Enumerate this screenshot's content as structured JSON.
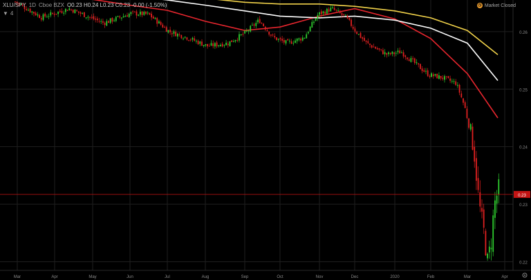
{
  "header": {
    "symbol": "XLU/SPY",
    "interval": "1D",
    "source": "Cboe BZX",
    "ohlc_text": "O0.23  H0.24  L0.23  C0.23  -0.00 (-1.50%)",
    "collapse_count": "4"
  },
  "market_status": {
    "text": "Market Closed",
    "icon": "clock-icon"
  },
  "colors": {
    "up": "#2ecc2e",
    "down": "#e02020",
    "ma_fast": "#e8262e",
    "ma_mid": "#ffffff",
    "ma_slow": "#f2d34a",
    "price_line": "#c41414",
    "grid": "#1f1f1f",
    "axis_text": "#8a8a8a"
  },
  "chart_data": {
    "type": "candlestick",
    "title": "",
    "x_ticks": [
      "Mar",
      "Apr",
      "May",
      "Jun",
      "Jul",
      "Aug",
      "Sep",
      "Oct",
      "Nov",
      "Dec",
      "2020",
      "Feb",
      "Mar",
      "Apr"
    ],
    "y_ticks": [
      "0.26",
      "0.25",
      "0.24",
      "0.23",
      "0.22"
    ],
    "ylim": [
      0.2185,
      0.2655
    ],
    "last_price": "0.23",
    "last_price_value": 0.2317,
    "grid": true,
    "candles_sample": [
      {
        "date": "2019-03",
        "open": 0.265,
        "close": 0.264
      },
      {
        "date": "2019-06",
        "open": 0.262,
        "close": 0.263
      },
      {
        "date": "2019-08",
        "open": 0.2565,
        "close": 0.2575
      },
      {
        "date": "2019-09",
        "open": 0.263,
        "close": 0.264
      },
      {
        "date": "2019-10",
        "open": 0.258,
        "close": 0.259
      },
      {
        "date": "2019-11",
        "open": 0.265,
        "close": 0.264
      },
      {
        "date": "2019-12",
        "open": 0.258,
        "close": 0.256
      },
      {
        "date": "2020-01",
        "open": 0.256,
        "close": 0.255
      },
      {
        "date": "2020-02",
        "open": 0.25,
        "close": 0.248
      },
      {
        "date": "2020-03",
        "open": 0.23,
        "close": 0.22
      },
      {
        "date": "2020-03-end",
        "open": 0.23,
        "close": 0.233
      }
    ],
    "series": [
      {
        "name": "",
        "color": "#e8262e",
        "x": [
          "2019-03",
          "2019-05",
          "2019-06",
          "2019-07",
          "2019-08",
          "2019-09",
          "2019-10",
          "2019-11",
          "2019-12",
          "2020-01",
          "2020-02",
          "2020-03",
          "2020-03-end"
        ],
        "values": [
          0.266,
          0.2656,
          0.2646,
          0.2637,
          0.2618,
          0.2602,
          0.2608,
          0.2627,
          0.264,
          0.2622,
          0.2588,
          0.2527,
          0.245
        ]
      },
      {
        "name": "",
        "color": "#ffffff",
        "x": [
          "2019-03",
          "2019-05",
          "2019-06",
          "2019-07",
          "2019-08",
          "2019-09",
          "2019-10",
          "2019-11",
          "2019-12",
          "2020-01",
          "2020-02",
          "2020-03",
          "2020-03-end"
        ],
        "values": [
          0.2675,
          0.2668,
          0.2662,
          0.2655,
          0.2646,
          0.2636,
          0.2627,
          0.2624,
          0.2627,
          0.262,
          0.2606,
          0.258,
          0.2515
        ]
      },
      {
        "name": "",
        "color": "#f2d34a",
        "x": [
          "2019-03",
          "2019-05",
          "2019-06",
          "2019-07",
          "2019-08",
          "2019-09",
          "2019-10",
          "2019-11",
          "2019-12",
          "2020-01",
          "2020-02",
          "2020-03",
          "2020-03-end"
        ],
        "values": [
          0.268,
          0.2676,
          0.2671,
          0.2665,
          0.2658,
          0.2651,
          0.2648,
          0.2648,
          0.2644,
          0.2636,
          0.2624,
          0.2602,
          0.256
        ]
      }
    ]
  }
}
